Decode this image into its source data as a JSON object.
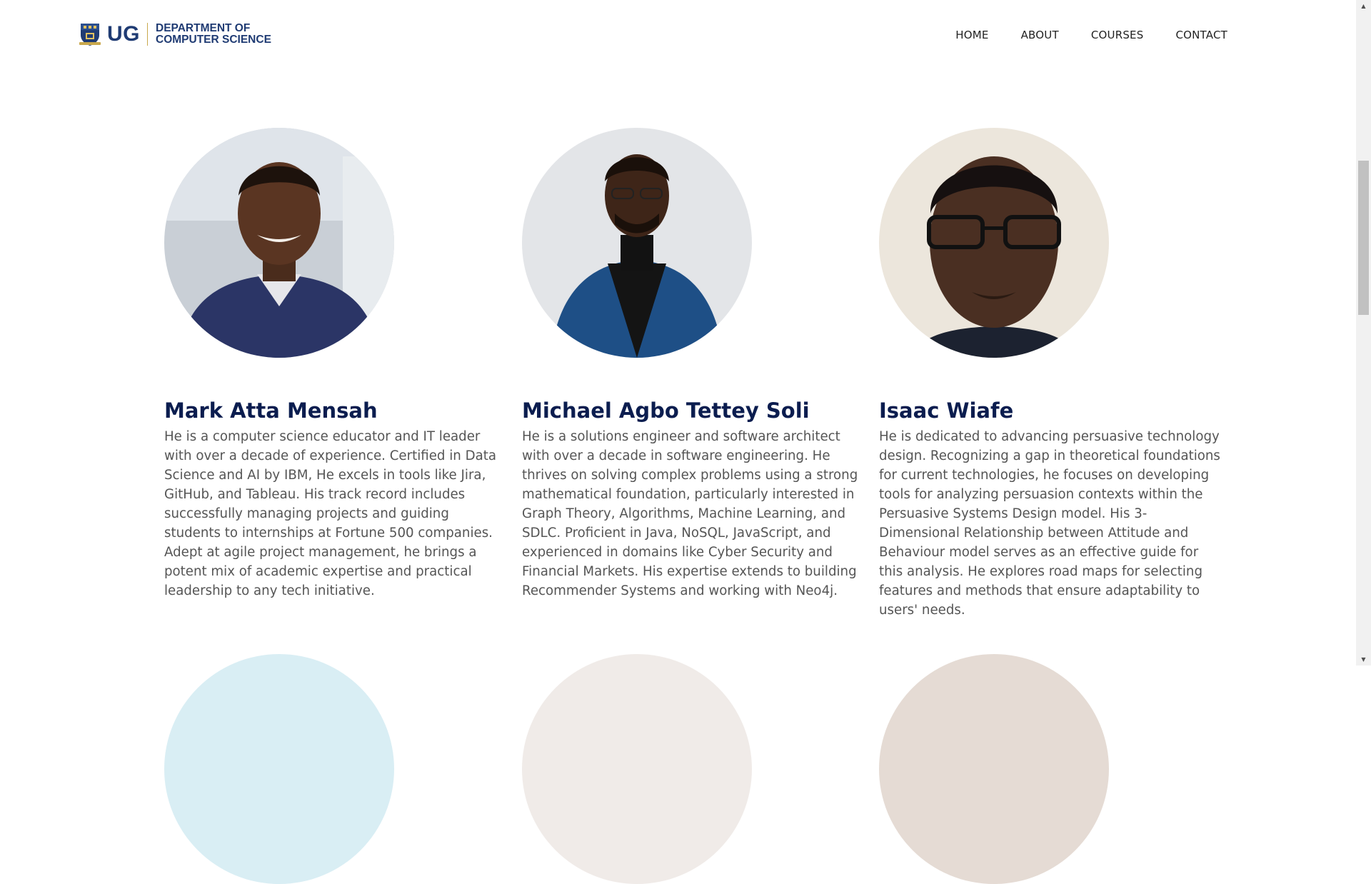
{
  "header": {
    "logo": {
      "short": "UG",
      "line1": "DEPARTMENT OF",
      "line2": "COMPUTER SCIENCE"
    },
    "nav": [
      "HOME",
      "ABOUT",
      "COURSES",
      "CONTACT"
    ]
  },
  "faculty": [
    {
      "name": "Mark Atta Mensah",
      "bio": "He is a computer science educator and IT leader with over a decade of experience. Certified in Data Science and AI by IBM, He excels in tools like Jira, GitHub, and Tableau. His track record includes successfully managing projects and guiding students to internships at Fortune 500 companies. Adept at agile project management, he brings a potent mix of academic expertise and practical leadership to any tech initiative."
    },
    {
      "name": "Michael Agbo Tettey Soli",
      "bio": "He is a solutions engineer and software architect with over a decade in software engineering. He thrives on solving complex problems using a strong mathematical foundation, particularly interested in Graph Theory, Algorithms, Machine Learning, and SDLC. Proficient in Java, NoSQL, JavaScript, and experienced in domains like Cyber Security and Financial Markets. His expertise extends to building Recommender Systems and working with Neo4j."
    },
    {
      "name": "Isaac Wiafe",
      "bio": "He is dedicated to advancing persuasive technology design. Recognizing a gap in theoretical foundations for current technologies, he focuses on developing tools for analyzing persuasion contexts within the Persuasive Systems Design model. His 3-Dimensional Relationship between Attitude and Behaviour model serves as an effective guide for this analysis. He explores road maps for selecting features and methods that ensure adaptability to users' needs."
    }
  ],
  "icons": {
    "scroll_up": "scroll-up-arrow-icon",
    "scroll_down": "scroll-down-arrow-icon"
  },
  "colors": {
    "brand_navy": "#1f3b73",
    "name_navy": "#0b1d4f",
    "body_text": "#555555"
  }
}
